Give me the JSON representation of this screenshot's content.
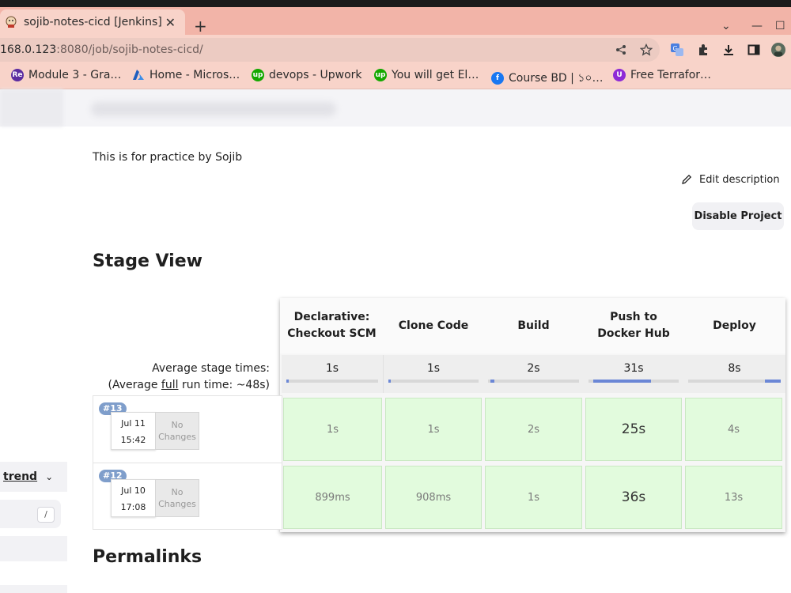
{
  "browser": {
    "tab_title": "sojib-notes-cicd [Jenkins]",
    "url_dim_prefix": "168.0.123",
    "url_rest": ":8080/job/sojib-notes-cicd/",
    "bookmarks": [
      {
        "label": "Module 3 - Gra…",
        "icon": "re-icon"
      },
      {
        "label": "Home - Micros…",
        "icon": "azure-icon"
      },
      {
        "label": "devops - Upwork",
        "icon": "upwork-icon"
      },
      {
        "label": "You will get El…",
        "icon": "upwork-icon"
      },
      {
        "label": "Course BD | ১০…",
        "icon": "facebook-icon"
      },
      {
        "label": "Free Terrafor…",
        "icon": "udemy-icon"
      }
    ]
  },
  "page": {
    "description": "This is for practice by Sojib",
    "edit_description": "Edit description",
    "disable_project": "Disable Project",
    "stage_view_title": "Stage View",
    "permalinks_title": "Permalinks"
  },
  "sidebar": {
    "trend_label": "trend",
    "search_shortcut": "/"
  },
  "stage_view": {
    "stages": [
      {
        "name_line1": "Declarative:",
        "name_line2": "Checkout SCM",
        "avg": "1s",
        "avg_fraction": 0.02
      },
      {
        "name_line1": "Clone Code",
        "name_line2": "",
        "avg": "1s",
        "avg_fraction": 0.02
      },
      {
        "name_line1": "Build",
        "name_line2": "",
        "avg": "2s",
        "avg_fraction": 0.04
      },
      {
        "name_line1": "Push to",
        "name_line2": "Docker Hub",
        "avg": "31s",
        "avg_fraction": 0.64
      },
      {
        "name_line1": "Deploy",
        "name_line2": "",
        "avg": "8s",
        "avg_fraction": 0.17
      }
    ],
    "avg_label_line1": "Average stage times:",
    "avg_label_prefix": "(Average ",
    "avg_label_link": "full",
    "avg_label_suffix": " run time: ~48s)",
    "runs": [
      {
        "badge": "#13",
        "date": "Jul 11",
        "time": "15:42",
        "changes_line1": "No",
        "changes_line2": "Changes",
        "durations": [
          "1s",
          "1s",
          "2s",
          "25s",
          "4s"
        ]
      },
      {
        "badge": "#12",
        "date": "Jul 10",
        "time": "17:08",
        "changes_line1": "No",
        "changes_line2": "Changes",
        "durations": [
          "899ms",
          "908ms",
          "1s",
          "36s",
          "13s"
        ]
      }
    ]
  },
  "colors": {
    "success_cell": "#e2fbdd",
    "progress_fill": "#6b87d6",
    "badge": "#7f9ecb",
    "chrome_tab": "#f8d3c9"
  }
}
